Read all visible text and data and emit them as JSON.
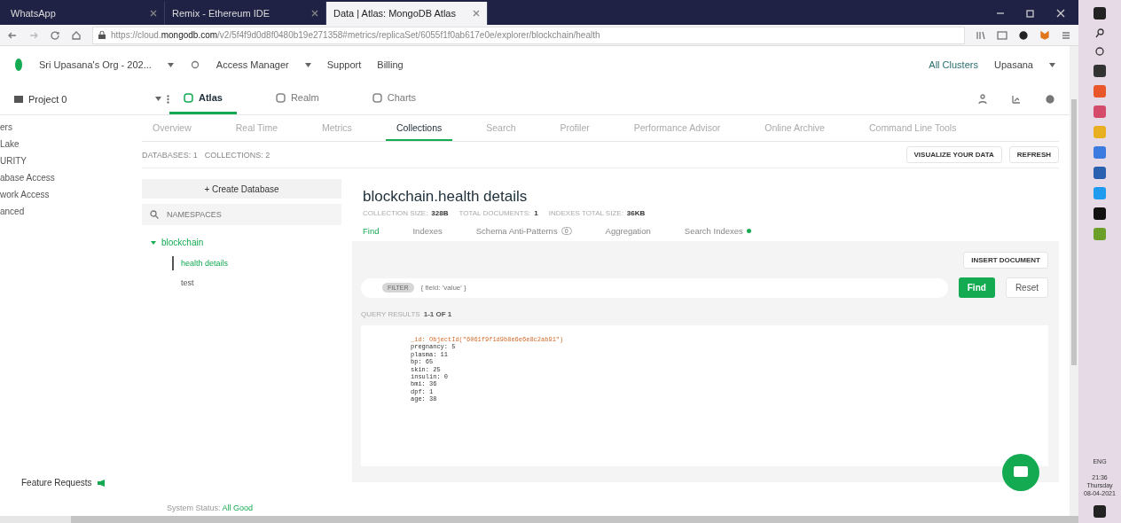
{
  "browser": {
    "tabs": [
      {
        "title": "WhatsApp",
        "selected": false
      },
      {
        "title": "Remix - Ethereum IDE",
        "selected": false
      },
      {
        "title": "Data | Atlas: MongoDB Atlas",
        "selected": true
      }
    ],
    "url_prefix": "https://cloud.",
    "url_domain": "mongodb.com",
    "url_rest": "/v2/5f4f9d0d8f0480b19e271358#metrics/replicaSet/6055f1f0ab617e0e/explorer/blockchain/health"
  },
  "org_bar": {
    "org": "Sri Upasana's Org - 202...",
    "access_manager": "Access Manager",
    "support": "Support",
    "billing": "Billing",
    "all_clusters": "All Clusters",
    "user": "Upasana"
  },
  "project_bar": {
    "project": "Project 0",
    "products": [
      {
        "label": "Atlas",
        "selected": true
      },
      {
        "label": "Realm",
        "selected": false
      },
      {
        "label": "Charts",
        "selected": false
      }
    ]
  },
  "sidebar": {
    "items": [
      "ers",
      "Lake",
      "URITY",
      "abase Access",
      "work Access",
      "anced"
    ],
    "feature_requests": "Feature Requests"
  },
  "cluster_tabs": [
    {
      "label": "Overview",
      "selected": false
    },
    {
      "label": "Real Time",
      "selected": false
    },
    {
      "label": "Metrics",
      "selected": false
    },
    {
      "label": "Collections",
      "selected": true
    },
    {
      "label": "Search",
      "selected": false
    },
    {
      "label": "Profiler",
      "selected": false
    },
    {
      "label": "Performance Advisor",
      "selected": false
    },
    {
      "label": "Online Archive",
      "selected": false
    },
    {
      "label": "Command Line Tools",
      "selected": false
    }
  ],
  "breadcrumb": {
    "databases": "DATABASES: 1",
    "collections": "COLLECTIONS: 2"
  },
  "visualize_button": "VISUALIZE YOUR DATA",
  "refresh_button": "REFRESH",
  "db_panel": {
    "create_button": "+ Create Database",
    "search_placeholder": "NAMESPACES",
    "tree": [
      {
        "name": "blockchain",
        "expanded": true,
        "children": [
          {
            "name": "health details",
            "selected": true
          },
          {
            "name": "test",
            "selected": false
          }
        ]
      }
    ]
  },
  "collection": {
    "title": "blockchain.health details",
    "stats": [
      {
        "label": "COLLECTION SIZE:",
        "value": "328B"
      },
      {
        "label": "TOTAL DOCUMENTS:",
        "value": "1"
      },
      {
        "label": "INDEXES TOTAL SIZE:",
        "value": "36KB"
      }
    ],
    "tabs": [
      {
        "label": "Find",
        "selected": true
      },
      {
        "label": "Indexes",
        "selected": false
      },
      {
        "label": "Schema Anti-Patterns",
        "selected": false,
        "badge": "0"
      },
      {
        "label": "Aggregation",
        "selected": false
      },
      {
        "label": "Search Indexes",
        "selected": false
      }
    ],
    "insert_button": "INSERT DOCUMENT",
    "filter_chip": "FILTER",
    "filter_placeholder": "{ field: 'value' }",
    "find_button": "Find",
    "reset_button": "Reset",
    "results_label": "QUERY RESULTS",
    "results_range": "1-1 OF 1",
    "document": [
      {
        "text": "_id: ObjectId(\"6061f9f1d9b8e6e6e8c2ab91\")",
        "kind": "id"
      },
      {
        "text": "pregnancy: 5",
        "kind": "plain"
      },
      {
        "text": "plasma: 11",
        "kind": "plain"
      },
      {
        "text": "bp: 65",
        "kind": "plain"
      },
      {
        "text": "skin: 25",
        "kind": "plain"
      },
      {
        "text": "insulin: 0",
        "kind": "plain"
      },
      {
        "text": "bmi: 36",
        "kind": "plain"
      },
      {
        "text": "dpf: 1",
        "kind": "plain"
      },
      {
        "text": "age: 38",
        "kind": "plain"
      }
    ]
  },
  "footer": {
    "status_label": "System Status:",
    "status_value": "All Good"
  },
  "taskbar": {
    "lang": "ENG",
    "time": "21:36",
    "day": "Thursday",
    "date": "08-04-2021"
  }
}
